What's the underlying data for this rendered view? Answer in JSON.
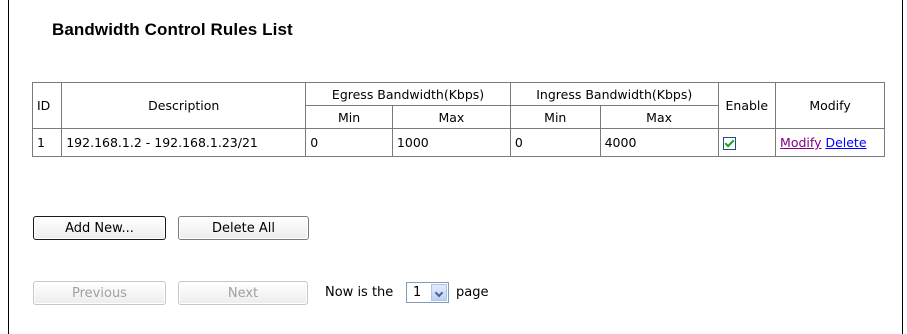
{
  "title": "Bandwidth Control Rules List",
  "table": {
    "headers": {
      "id": "ID",
      "description": "Description",
      "egress": "Egress Bandwidth(Kbps)",
      "ingress": "Ingress Bandwidth(Kbps)",
      "enable": "Enable",
      "modify": "Modify",
      "min": "Min",
      "max": "Max"
    },
    "rows": [
      {
        "id": "1",
        "description": "192.168.1.2 - 192.168.1.23/21",
        "egress_min": "0",
        "egress_max": "1000",
        "ingress_min": "0",
        "ingress_max": "4000",
        "enabled": true,
        "modify_label": "Modify",
        "delete_label": "Delete"
      }
    ]
  },
  "buttons": {
    "add_new": "Add New...",
    "delete_all": "Delete All",
    "previous": "Previous",
    "next": "Next"
  },
  "pager": {
    "prefix": "Now is the",
    "current_page": "1",
    "suffix": "page"
  },
  "colors": {
    "modify_link": "#800080",
    "delete_link": "#0000ff",
    "checkbox_check": "#21a121"
  }
}
